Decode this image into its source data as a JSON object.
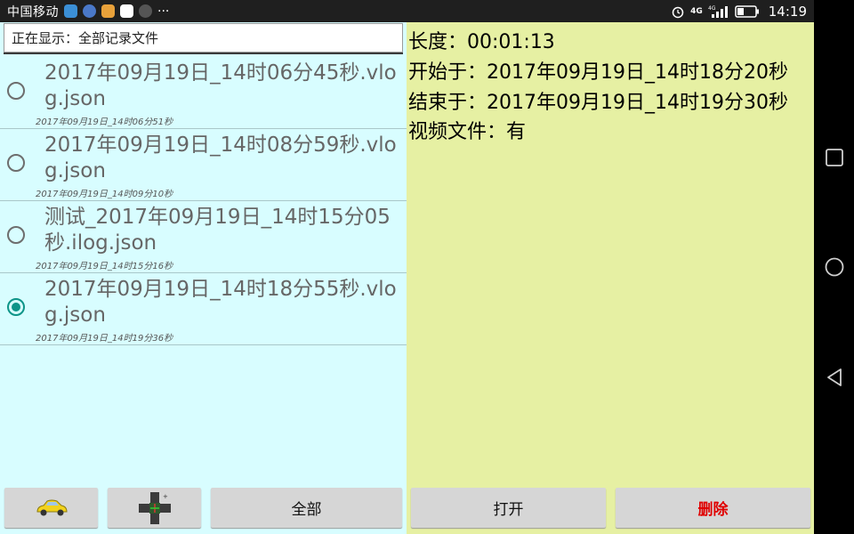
{
  "statusbar": {
    "carrier": "中国移动",
    "more": "···",
    "network": "4G",
    "time": "14:19"
  },
  "filter": {
    "text": "正在显示：全部记录文件"
  },
  "files": [
    {
      "name": "2017年09月19日_14时06分45秒.vlog.json",
      "date": "2017年09月19日_14时06分51秒",
      "selected": false
    },
    {
      "name": "2017年09月19日_14时08分59秒.vlog.json",
      "date": "2017年09月19日_14时09分10秒",
      "selected": false
    },
    {
      "name": "测试_2017年09月19日_14时15分05秒.ilog.json",
      "date": "2017年09月19日_14时15分16秒",
      "selected": false
    },
    {
      "name": "2017年09月19日_14时18分55秒.vlog.json",
      "date": "2017年09月19日_14时19分36秒",
      "selected": true
    }
  ],
  "left_buttons": {
    "all_label": "全部"
  },
  "details": {
    "length": "长度：00:01:13",
    "start": "开始于：2017年09月19日_14时18分20秒",
    "end": "结束于：2017年09月19日_14时19分30秒",
    "video": "视频文件：有"
  },
  "right_buttons": {
    "open_label": "打开",
    "delete_label": "删除"
  },
  "colors": {
    "left_bg": "#d8fdff",
    "right_bg": "#e6f0a3",
    "accent": "#0d9488",
    "delete": "#e00000"
  }
}
